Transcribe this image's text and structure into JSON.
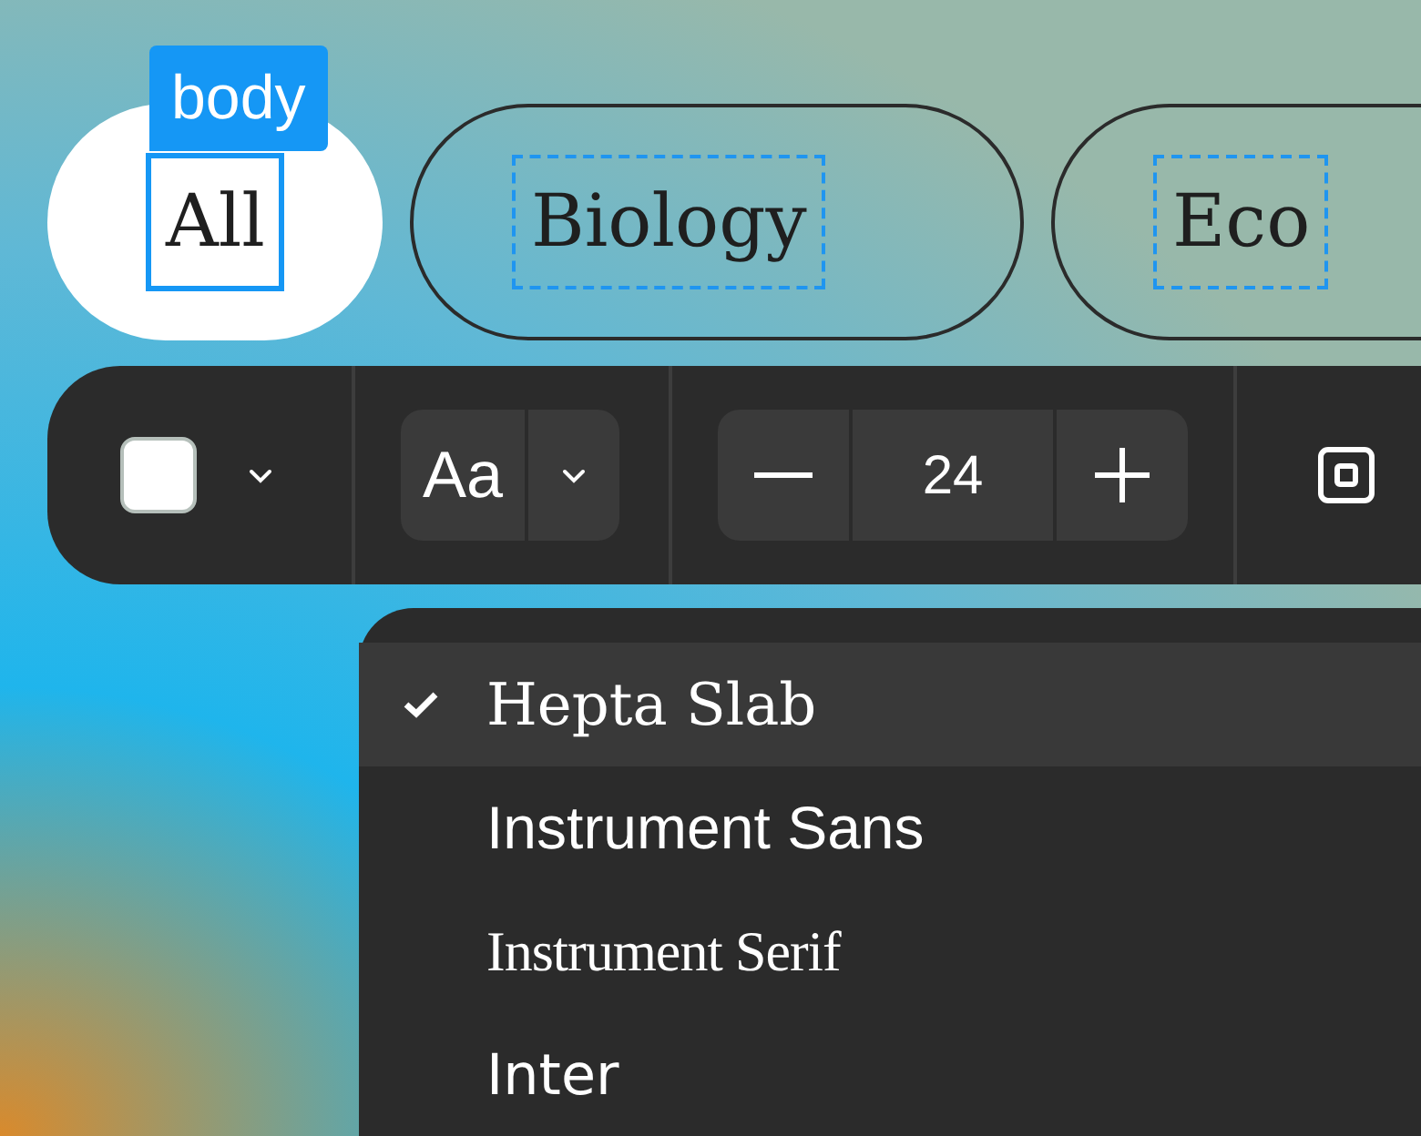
{
  "chips": [
    {
      "label": "All",
      "selected": true,
      "tag": "body"
    },
    {
      "label": "Biology",
      "selected": false
    },
    {
      "label": "Eco",
      "selected": false
    }
  ],
  "toolbar": {
    "font_button": "Aa",
    "size": "24"
  },
  "font_menu": [
    {
      "label": "Hepta Slab",
      "selected": true,
      "kind": "slab"
    },
    {
      "label": "Instrument Sans",
      "selected": false,
      "kind": "sans"
    },
    {
      "label": "Instrument Serif",
      "selected": false,
      "kind": "serif"
    },
    {
      "label": "Inter",
      "selected": false,
      "kind": "grotesk"
    }
  ]
}
